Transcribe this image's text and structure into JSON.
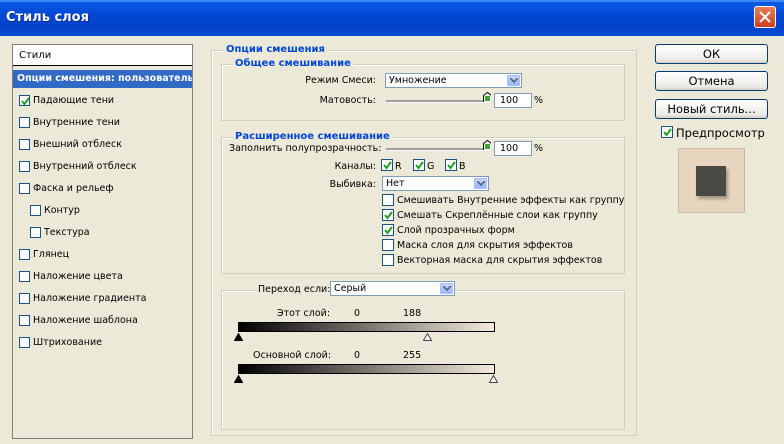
{
  "window": {
    "title": "Стиль слоя"
  },
  "styles_panel": {
    "header": "Стили",
    "items": [
      {
        "label": "Опции смешения: пользовательс",
        "selected": true,
        "checkbox": false,
        "checked": false,
        "indent": false
      },
      {
        "label": "Падающие тени",
        "selected": false,
        "checkbox": true,
        "checked": true,
        "indent": false
      },
      {
        "label": "Внутренние тени",
        "selected": false,
        "checkbox": true,
        "checked": false,
        "indent": false
      },
      {
        "label": "Внешний отблеск",
        "selected": false,
        "checkbox": true,
        "checked": false,
        "indent": false
      },
      {
        "label": "Внутренний отблеск",
        "selected": false,
        "checkbox": true,
        "checked": false,
        "indent": false
      },
      {
        "label": "Фаска и рельеф",
        "selected": false,
        "checkbox": true,
        "checked": false,
        "indent": false
      },
      {
        "label": "Контур",
        "selected": false,
        "checkbox": true,
        "checked": false,
        "indent": true
      },
      {
        "label": "Текстура",
        "selected": false,
        "checkbox": true,
        "checked": false,
        "indent": true
      },
      {
        "label": "Глянец",
        "selected": false,
        "checkbox": true,
        "checked": false,
        "indent": false
      },
      {
        "label": "Наложение цвета",
        "selected": false,
        "checkbox": true,
        "checked": false,
        "indent": false
      },
      {
        "label": "Наложение градиента",
        "selected": false,
        "checkbox": true,
        "checked": false,
        "indent": false
      },
      {
        "label": "Наложение шаблона",
        "selected": false,
        "checkbox": true,
        "checked": false,
        "indent": false
      },
      {
        "label": "Штрихование",
        "selected": false,
        "checkbox": true,
        "checked": false,
        "indent": false
      }
    ]
  },
  "blending": {
    "title": "Опции смешения",
    "general": {
      "title": "Общее смешивание",
      "mode_label": "Режим Смеси:",
      "mode_value": "Умножение",
      "opacity_label": "Матовость:",
      "opacity_value": "100",
      "opacity_level": 1.0,
      "percent": "%"
    },
    "advanced": {
      "title": "Расширенное смешивание",
      "fill_label": "Заполнить полупрозрачность:",
      "fill_value": "100",
      "fill_level": 1.0,
      "percent": "%",
      "channels_label": "Каналы:",
      "channels": [
        {
          "label": "R",
          "checked": true
        },
        {
          "label": "G",
          "checked": true
        },
        {
          "label": "B",
          "checked": true
        }
      ],
      "knockout_label": "Выбивка:",
      "knockout_value": "Нет",
      "options": [
        {
          "label": "Смешивать Внутренние эффекты как группу",
          "checked": false
        },
        {
          "label": "Смешать Скреплённые слои как группу",
          "checked": true
        },
        {
          "label": "Слой прозрачных форм",
          "checked": true
        },
        {
          "label": "Маска слоя для скрытия эффектов",
          "checked": false
        },
        {
          "label": "Векторная маска для скрытия эффектов",
          "checked": false
        }
      ]
    },
    "blend_if": {
      "label": "Переход если:",
      "value": "Серый",
      "this_layer_label": "Этот слой:",
      "this_layer_low": "0",
      "this_layer_high": "188",
      "underlying_label": "Основной слой:",
      "underlying_low": "0",
      "underlying_high": "255",
      "gradient_start": "#000000",
      "gradient_end": "#f6eadd"
    }
  },
  "buttons": {
    "ok": "ОК",
    "cancel": "Отмена",
    "new_style": "Новый стиль...",
    "preview_label": "Предпросмотр",
    "preview_checked": true
  },
  "colors": {
    "title_bar": "#0447d4",
    "selection": "#316ac5",
    "group_title": "#0046d5",
    "dialog_bg": "#ece9d8",
    "preview_bg": "#e7d5c0",
    "preview_square": "#4b4944"
  }
}
